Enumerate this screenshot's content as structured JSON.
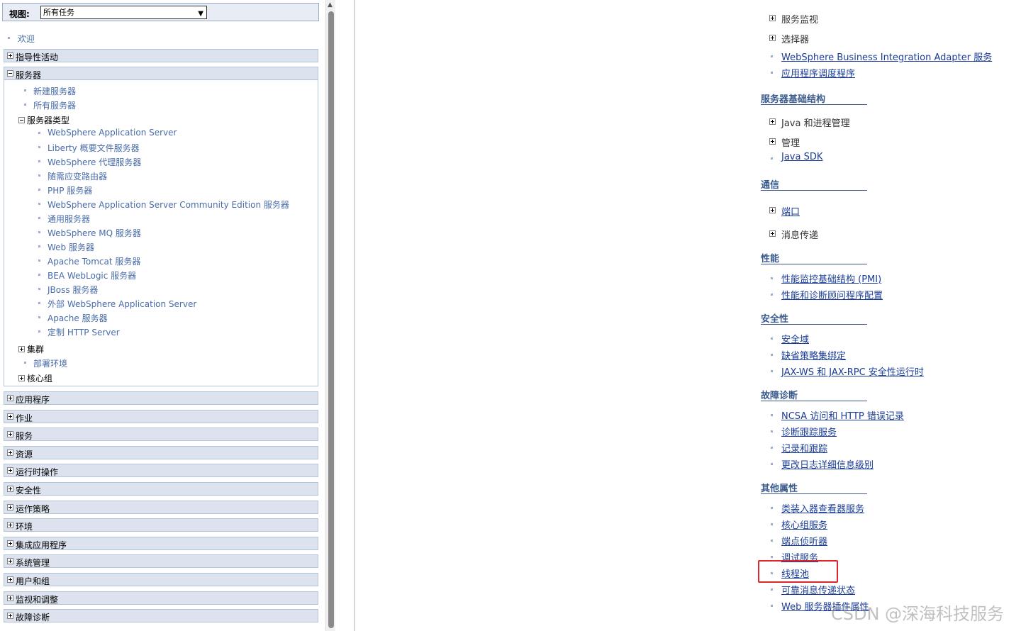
{
  "nav": {
    "view_label": "视图:",
    "view_selected": "所有任务",
    "welcome": "欢迎",
    "guided_activities": "指导性活动",
    "servers": {
      "label": "服务器",
      "new_server": "新建服务器",
      "all_servers": "所有服务器",
      "server_types": {
        "label": "服务器类型",
        "items": [
          "WebSphere Application Server",
          "Liberty 概要文件服务器",
          "WebSphere 代理服务器",
          "随需应变路由器",
          "PHP 服务器",
          "WebSphere Application Server Community Edition 服务器",
          "通用服务器",
          "WebSphere MQ 服务器",
          "Web 服务器",
          "Apache Tomcat 服务器",
          "BEA WebLogic 服务器",
          "JBoss 服务器",
          "外部 WebSphere Application Server",
          "Apache 服务器",
          "定制 HTTP Server"
        ]
      },
      "clusters": "集群",
      "deployment_env": "部署环境",
      "core_groups": "核心组"
    },
    "categories": [
      "应用程序",
      "作业",
      "服务",
      "资源",
      "运行时操作",
      "安全性",
      "运作策略",
      "环境",
      "集成应用程序",
      "系统管理",
      "用户和组",
      "监视和调整",
      "故障诊断"
    ]
  },
  "content": {
    "top_items": [
      {
        "text": "服务监视",
        "kind": "expand"
      },
      {
        "text": "选择器",
        "kind": "expand"
      },
      {
        "text": "WebSphere Business Integration Adapter 服务",
        "kind": "link"
      },
      {
        "text": "应用程序调度程序",
        "kind": "link"
      }
    ],
    "sections": {
      "infra": {
        "title": "服务器基础结构",
        "items": [
          {
            "text": "Java 和进程管理",
            "kind": "expand"
          },
          {
            "text": "管理",
            "kind": "expand"
          },
          {
            "text": "Java SDK",
            "kind": "link"
          }
        ]
      },
      "comm": {
        "title": "通信",
        "items": [
          {
            "text": "端口",
            "kind": "expand-link"
          },
          {
            "text": "消息传递",
            "kind": "expand"
          }
        ]
      },
      "perf": {
        "title": "性能",
        "items": [
          {
            "text": "性能监控基础结构 (PMI)",
            "kind": "link"
          },
          {
            "text": "性能和诊断顾问程序配置",
            "kind": "link"
          }
        ]
      },
      "security": {
        "title": "安全性",
        "items": [
          {
            "text": "安全域",
            "kind": "link"
          },
          {
            "text": "缺省策略集绑定",
            "kind": "link"
          },
          {
            "text": "JAX-WS 和 JAX-RPC 安全性运行时",
            "kind": "link"
          }
        ]
      },
      "trouble": {
        "title": "故障诊断",
        "items": [
          {
            "text": "NCSA 访问和 HTTP 错误记录",
            "kind": "link"
          },
          {
            "text": "诊断跟踪服务",
            "kind": "link"
          },
          {
            "text": "记录和跟踪",
            "kind": "link"
          },
          {
            "text": "更改日志详细信息级别",
            "kind": "link"
          }
        ]
      },
      "other": {
        "title": "其他属性",
        "items": [
          {
            "text": "类装入器查看器服务",
            "kind": "link"
          },
          {
            "text": "核心组服务",
            "kind": "link"
          },
          {
            "text": "端点侦听器",
            "kind": "link"
          },
          {
            "text": "调试服务",
            "kind": "link"
          },
          {
            "text": "线程池",
            "kind": "link"
          },
          {
            "text": "可靠消息传递状态",
            "kind": "link"
          },
          {
            "text": "Web 服务器插件属性",
            "kind": "link"
          }
        ]
      }
    },
    "watermark": "CSDN @深海科技服务"
  },
  "colors": {
    "nav_link": "#486ca8",
    "content_link": "#1a3c98",
    "section_title": "#3a5a8c",
    "category_bar": "#dde3ee",
    "highlight": "#e0262b"
  }
}
